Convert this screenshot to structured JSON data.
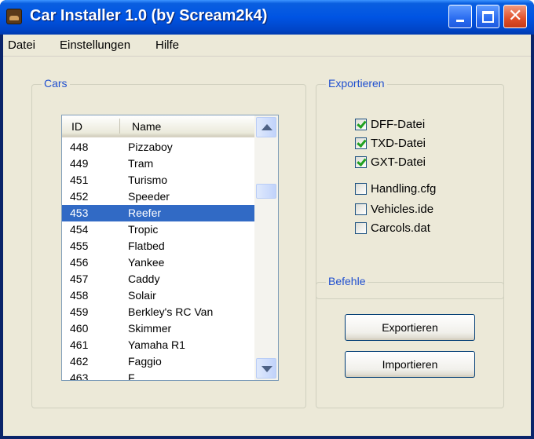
{
  "window": {
    "title": "Car Installer 1.0 (by Scream2k4)"
  },
  "menu": [
    "Datei",
    "Einstellungen",
    "Hilfe"
  ],
  "cars": {
    "label": "Cars",
    "columns": [
      "ID",
      "Name"
    ],
    "rows": [
      {
        "id": "448",
        "name": "Pizzaboy"
      },
      {
        "id": "449",
        "name": "Tram"
      },
      {
        "id": "451",
        "name": "Turismo"
      },
      {
        "id": "452",
        "name": "Speeder"
      },
      {
        "id": "453",
        "name": "Reefer",
        "selected": true
      },
      {
        "id": "454",
        "name": "Tropic"
      },
      {
        "id": "455",
        "name": "Flatbed"
      },
      {
        "id": "456",
        "name": "Yankee"
      },
      {
        "id": "457",
        "name": "Caddy"
      },
      {
        "id": "458",
        "name": "Solair"
      },
      {
        "id": "459",
        "name": "Berkley's RC Van"
      },
      {
        "id": "460",
        "name": "Skimmer"
      },
      {
        "id": "461",
        "name": "Yamaha R1"
      },
      {
        "id": "462",
        "name": "Faggio"
      },
      {
        "id": "463",
        "name": "F..."
      }
    ]
  },
  "export": {
    "label": "Exportieren",
    "options": [
      {
        "label": "DFF-Datei",
        "checked": true
      },
      {
        "label": "TXD-Datei",
        "checked": true
      },
      {
        "label": "GXT-Datei",
        "checked": true
      },
      {
        "label": "Handling.cfg",
        "checked": false
      },
      {
        "label": "Vehicles.ide",
        "checked": false
      },
      {
        "label": "Carcols.dat",
        "checked": false
      }
    ]
  },
  "commands": {
    "label": "Befehle",
    "export_button": "Exportieren",
    "import_button": "Importieren"
  }
}
